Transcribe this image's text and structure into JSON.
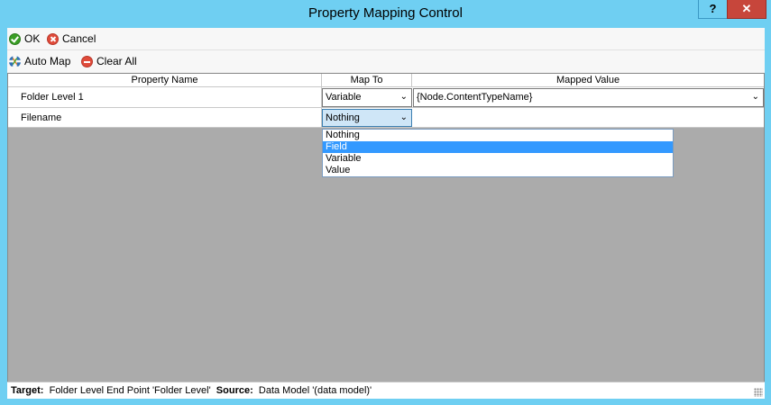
{
  "window": {
    "title": "Property Mapping Control",
    "help_label": "?",
    "close_label": "✕"
  },
  "toolbar1": {
    "ok_label": "OK",
    "cancel_label": "Cancel"
  },
  "toolbar2": {
    "automap_label": "Auto Map",
    "clear_label": "Clear All"
  },
  "grid": {
    "columns": [
      "Property Name",
      "Map To",
      "Mapped Value"
    ],
    "rows": [
      {
        "property": "Folder Level 1",
        "map_to": "Variable",
        "mapped_value": "{Node.ContentTypeName}"
      },
      {
        "property": "Filename",
        "map_to": "Nothing",
        "mapped_value": ""
      }
    ],
    "dropdown_options": [
      "Nothing",
      "Field",
      "Variable",
      "Value"
    ],
    "dropdown_highlighted": "Field"
  },
  "status": {
    "target_label": "Target:",
    "target_value": "Folder Level End Point 'Folder Level'",
    "source_label": "Source:",
    "source_value": "Data Model '(data model)'"
  },
  "colors": {
    "titlebar": "#6fcff2",
    "close": "#c7463b",
    "selection": "#3399ff"
  }
}
